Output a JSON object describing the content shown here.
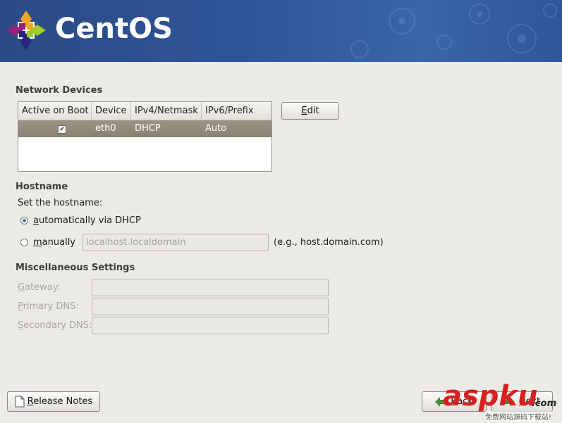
{
  "banner": {
    "brand": "CentOS"
  },
  "network_devices": {
    "title": "Network Devices",
    "columns": [
      "Active on Boot",
      "Device",
      "IPv4/Netmask",
      "IPv6/Prefix"
    ],
    "rows": [
      {
        "active": true,
        "device": "eth0",
        "ipv4": "DHCP",
        "ipv6": "Auto"
      }
    ],
    "edit_label": "Edit"
  },
  "hostname": {
    "title": "Hostname",
    "prompt": "Set the hostname:",
    "auto_label": "automatically via DHCP",
    "manual_label": "manually",
    "manual_value": "localhost.localdomain",
    "example": "(e.g., host.domain.com)",
    "selected": "auto"
  },
  "misc": {
    "title": "Miscellaneous Settings",
    "gateway_label": "Gateway:",
    "primary_dns_label": "Primary DNS:",
    "secondary_dns_label": "Secondary DNS:",
    "gateway_value": "",
    "primary_dns_value": "",
    "secondary_dns_value": ""
  },
  "footer": {
    "release_notes_label": "Release Notes",
    "back_label": "Back",
    "next_label": "Next"
  },
  "watermark": {
    "text": "aspku",
    "tld": ".com",
    "subtitle": "免费网站源码下载站!"
  },
  "colors": {
    "banner": "#2f5597",
    "selected_row": "#8f8677",
    "accent": "#4a6fb5"
  }
}
